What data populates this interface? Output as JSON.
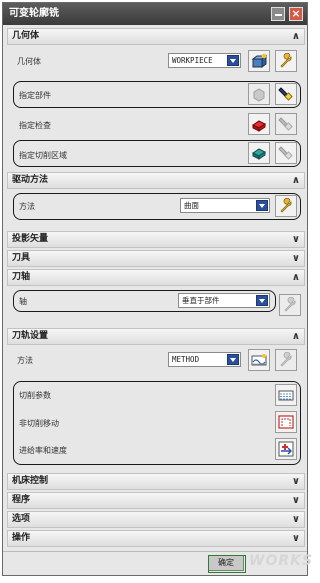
{
  "title": "可变轮廓铣",
  "sections": {
    "geometry": {
      "title": "几何体",
      "state": "expanded"
    },
    "drive": {
      "title": "驱动方法",
      "state": "expanded"
    },
    "projection": {
      "title": "投影矢量",
      "state": "collapsed"
    },
    "tool": {
      "title": "刀具",
      "state": "collapsed"
    },
    "axis": {
      "title": "刀轴",
      "state": "expanded"
    },
    "path": {
      "title": "刀轨设置",
      "state": "expanded"
    },
    "machine": {
      "title": "机床控制",
      "state": "collapsed"
    },
    "program": {
      "title": "程序",
      "state": "collapsed"
    },
    "options": {
      "title": "选项",
      "state": "collapsed"
    },
    "actions": {
      "title": "操作",
      "state": "collapsed"
    }
  },
  "geometry": {
    "label": "几何体",
    "value": "WORKPIECE",
    "specify_part": "指定部件",
    "specify_check": "指定检查",
    "specify_cut_area": "指定切削区域"
  },
  "drive": {
    "label": "方法",
    "value": "曲面"
  },
  "axis": {
    "label": "轴",
    "value": "垂直于部件"
  },
  "path": {
    "label": "方法",
    "value": "METHOD",
    "cut_params": "切削参数",
    "non_cut_moves": "非切削移动",
    "feeds_speeds": "进给率和速度"
  },
  "footer": {
    "ok": "确定",
    "watermark": "WORKS"
  },
  "icons": {
    "chevron_up": "chevron-up-icon",
    "chevron_down": "chevron-down-icon"
  }
}
